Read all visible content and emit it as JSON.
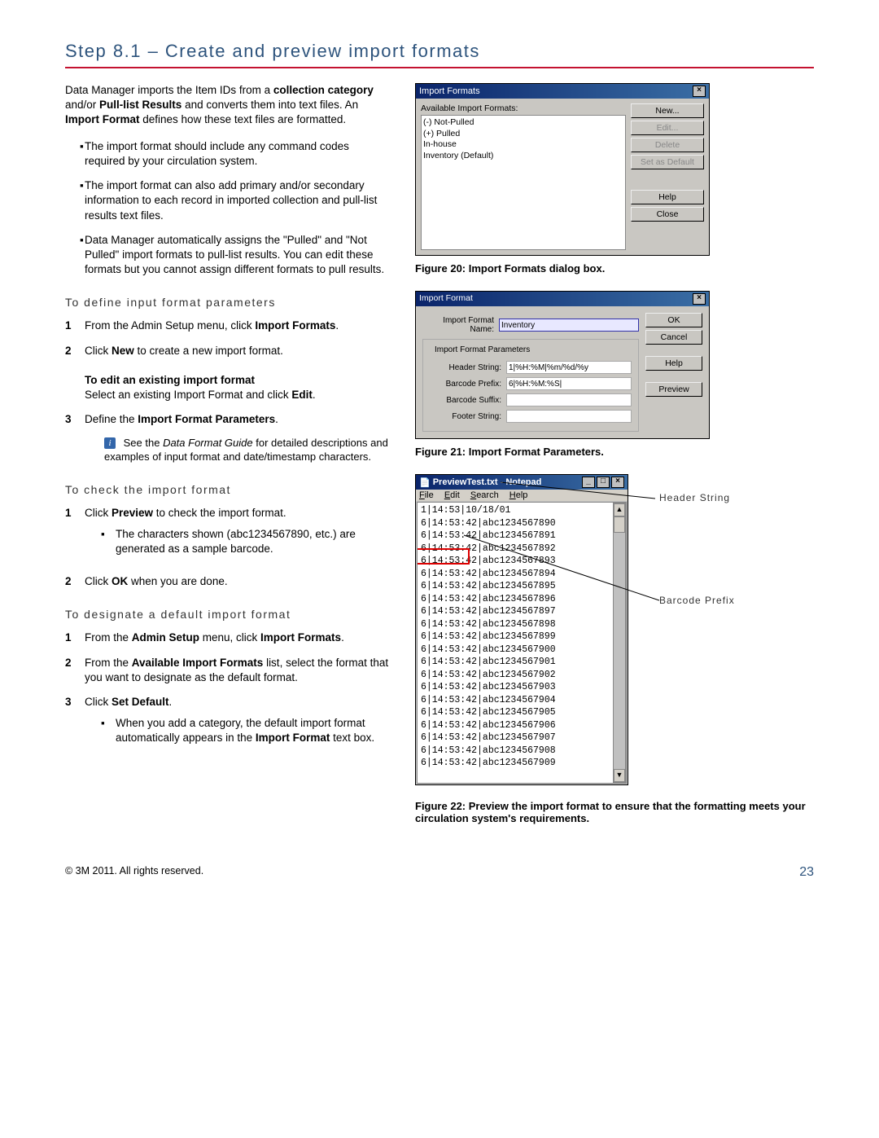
{
  "title": "Step 8.1 – Create and preview import formats",
  "intro": {
    "p1a": "Data Manager imports the Item IDs from a ",
    "p1b": "collection category",
    "p1c": " and/or ",
    "p1d": "Pull-list Results",
    "p1e": " and converts them into text files. An ",
    "p1f": "Import Format",
    "p1g": " defines how these text files are formatted."
  },
  "bullets": [
    "The import format should include any command codes required by your circulation system.",
    "The import format can also add primary and/or secondary information to each record in imported collection and pull-list results text files.",
    "Data Manager automatically assigns the \"Pulled\" and \"Not Pulled\" import formats to pull-list results. You can edit these formats but you cannot assign different formats to pull results."
  ],
  "sub1": "To define input format parameters",
  "steps1": {
    "s1a": "From the Admin Setup menu, click ",
    "s1b": "Import Formats",
    "s1c": ".",
    "s2a": "Click ",
    "s2b": "New",
    "s2c": " to create a new import format.",
    "s2d": "To edit an existing import format",
    "s2e": "Select an existing Import Format and click ",
    "s2f": "Edit",
    "s2g": ".",
    "s3a": "Define the ",
    "s3b": "Import Format Parameters",
    "s3c": ".",
    "note_a": "See the ",
    "note_b": "Data Format Guide",
    "note_c": " for detailed descriptions and examples of input format and date/timestamp characters."
  },
  "sub2": "To check the import format",
  "steps2": {
    "s1a": "Click ",
    "s1b": "Preview",
    "s1c": " to check the import format.",
    "s1d": "The characters shown (abc1234567890, etc.) are generated as a sample barcode.",
    "s2a": "Click ",
    "s2b": "OK",
    "s2c": " when you are done."
  },
  "sub3": "To designate a default import format",
  "steps3": {
    "s1a": "From the ",
    "s1b": "Admin Setup",
    "s1c": " menu, click ",
    "s1d": "Import Formats",
    "s1e": ".",
    "s2a": "From the ",
    "s2b": "Available Import Formats",
    "s2c": " list, select the format that you want to designate as the default format.",
    "s3a": "Click ",
    "s3b": "Set Default",
    "s3c": ".",
    "s3d": "When you add a category, the default import format automatically appears in the ",
    "s3e": "Import Format",
    "s3f": " text box."
  },
  "dialog1": {
    "title": "Import Formats",
    "label": "Available Import Formats:",
    "items": [
      "(-) Not-Pulled",
      "(+) Pulled",
      "In-house",
      "Inventory (Default)"
    ],
    "buttons": {
      "new": "New...",
      "edit": "Edit...",
      "delete": "Delete",
      "setdef": "Set as Default",
      "help": "Help",
      "close": "Close"
    }
  },
  "caption1": "Figure 20: Import Formats dialog box.",
  "dialog2": {
    "title": "Import Format",
    "name_lbl": "Import Format Name:",
    "name_val": "Inventory",
    "fs_title": "Import Format Parameters",
    "hs_lbl": "Header String:",
    "hs_val": "1|%H:%M|%m/%d/%y",
    "bp_lbl": "Barcode Prefix:",
    "bp_val": "6|%H:%M:%S|",
    "bs_lbl": "Barcode Suffix:",
    "fs_lbl": "Footer String:",
    "buttons": {
      "ok": "OK",
      "cancel": "Cancel",
      "help": "Help",
      "preview": "Preview"
    }
  },
  "caption2": "Figure 21: Import Format Parameters.",
  "notepad": {
    "title": "PreviewTest.txt - Notepad",
    "menu": {
      "file": "File",
      "edit": "Edit",
      "search": "Search",
      "help": "Help"
    },
    "lines": [
      "1|14:53|10/18/01",
      "6|14:53:42|abc1234567890",
      "6|14:53:42|abc1234567891",
      "6|14:53:42|abc1234567892",
      "6|14:53:42|abc1234567893",
      "6|14:53:42|abc1234567894",
      "6|14:53:42|abc1234567895",
      "6|14:53:42|abc1234567896",
      "6|14:53:42|abc1234567897",
      "6|14:53:42|abc1234567898",
      "6|14:53:42|abc1234567899",
      "6|14:53:42|abc1234567900",
      "6|14:53:42|abc1234567901",
      "6|14:53:42|abc1234567902",
      "6|14:53:42|abc1234567903",
      "6|14:53:42|abc1234567904",
      "6|14:53:42|abc1234567905",
      "6|14:53:42|abc1234567906",
      "6|14:53:42|abc1234567907",
      "6|14:53:42|abc1234567908",
      "6|14:53:42|abc1234567909"
    ],
    "annot1": "Header String",
    "annot2": "Barcode Prefix"
  },
  "caption3": "Figure 22: Preview the import format to ensure that the formatting meets your circulation system's requirements.",
  "footer": {
    "copyright": "© 3M 2011. All rights reserved.",
    "page": "23"
  }
}
